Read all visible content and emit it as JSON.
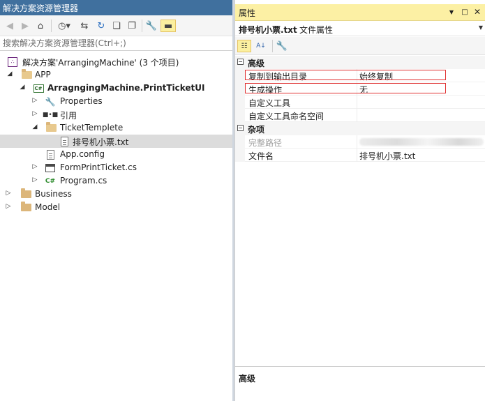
{
  "solution_explorer": {
    "title": "解决方案资源管理器",
    "search_placeholder": "搜索解决方案资源管理器(Ctrl+;)",
    "tree": [
      {
        "label": "解决方案'ArrangingMachine' (3 个项目)",
        "icon": "solution-icon",
        "bold": false
      },
      {
        "label": "APP",
        "icon": "folder-open-icon",
        "bold": false
      },
      {
        "label": "ArragngingMachine.PrintTicketUI",
        "icon": "csharp-project-icon",
        "bold": true
      },
      {
        "label": "Properties",
        "icon": "wrench-icon",
        "bold": false
      },
      {
        "label": "引用",
        "icon": "references-icon",
        "bold": false
      },
      {
        "label": "TicketTemplete",
        "icon": "folder-open-icon",
        "bold": false
      },
      {
        "label": "排号机小票.txt",
        "icon": "text-file-icon",
        "bold": false,
        "selected": true
      },
      {
        "label": "App.config",
        "icon": "config-file-icon",
        "bold": false
      },
      {
        "label": "FormPrintTicket.cs",
        "icon": "form-icon",
        "bold": false
      },
      {
        "label": "Program.cs",
        "icon": "csharp-file-icon",
        "bold": false
      },
      {
        "label": "Business",
        "icon": "folder-icon",
        "bold": false
      },
      {
        "label": "Model",
        "icon": "folder-icon",
        "bold": false
      }
    ]
  },
  "properties": {
    "title": "属性",
    "object_name": "排号机小票.txt",
    "object_type": "文件属性",
    "categories": [
      {
        "name": "高级",
        "rows": [
          {
            "name": "复制到输出目录",
            "value": "始终复制",
            "highlighted": true
          },
          {
            "name": "生成操作",
            "value": "无",
            "highlighted": true
          },
          {
            "name": "自定义工具",
            "value": ""
          },
          {
            "name": "自定义工具命名空间",
            "value": ""
          }
        ]
      },
      {
        "name": "杂项",
        "rows": [
          {
            "name": "完整路径",
            "value": "",
            "readonly": true,
            "blurred": true
          },
          {
            "name": "文件名",
            "value": "排号机小票.txt"
          }
        ]
      }
    ],
    "description_title": "高级"
  },
  "colors": {
    "title_bar": "#40709e",
    "properties_title_bar": "#fcf0a4",
    "selection": "#dcdcdc",
    "highlight_border": "#e03030"
  }
}
